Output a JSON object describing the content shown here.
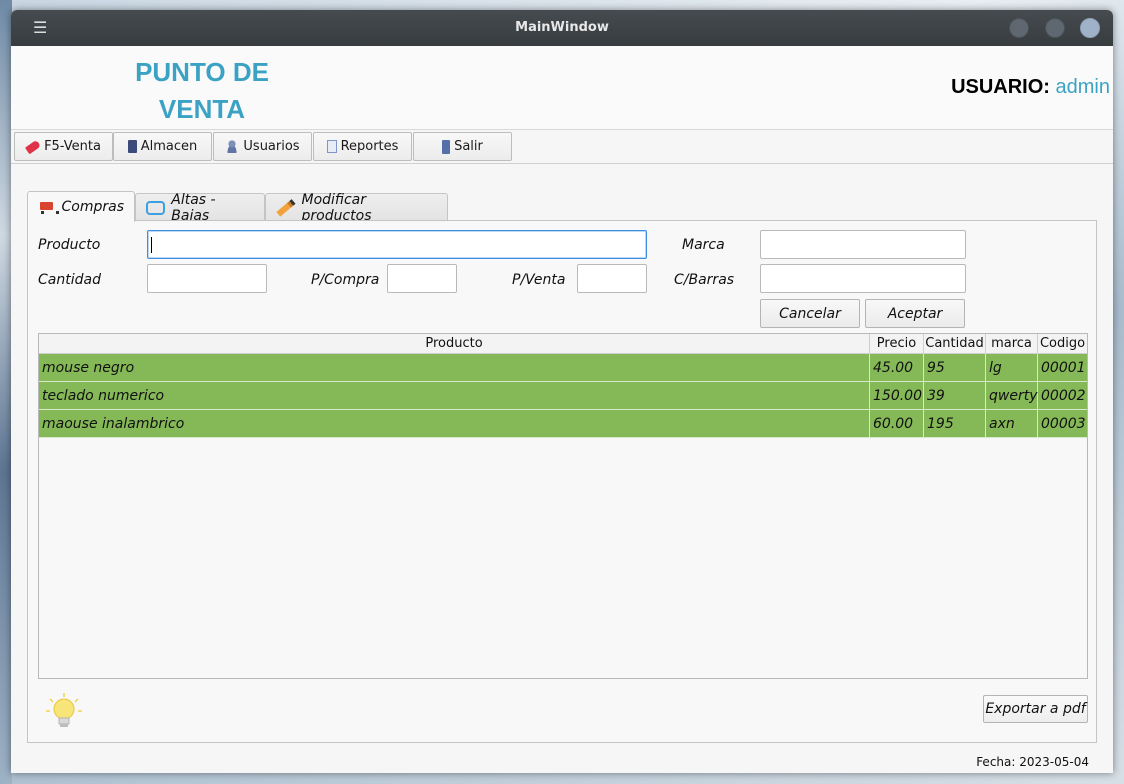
{
  "window": {
    "title": "MainWindow"
  },
  "header": {
    "brand_line1": "PUNTO DE",
    "brand_line2": "VENTA",
    "user_label": "USUARIO:",
    "user_name": "admin"
  },
  "toolbar": {
    "buttons": [
      {
        "label": "F5-Venta",
        "icon": "tag-icon"
      },
      {
        "label": "Almacen",
        "icon": "box-icon"
      },
      {
        "label": "Usuarios",
        "icon": "users-icon"
      },
      {
        "label": "Reportes",
        "icon": "document-icon"
      },
      {
        "label": "Salir",
        "icon": "exit-door-icon"
      }
    ]
  },
  "tabs": [
    {
      "label": "Compras",
      "icon": "shopping-cart-icon",
      "active": true
    },
    {
      "label": "Altas - Bajas",
      "icon": "swap-arrows-icon",
      "active": false
    },
    {
      "label": "Modificar productos",
      "icon": "pencil-icon",
      "active": false
    }
  ],
  "form": {
    "producto_label": "Producto",
    "producto_value": "",
    "marca_label": "Marca",
    "marca_value": "",
    "cantidad_label": "Cantidad",
    "cantidad_value": "",
    "pcompra_label": "P/Compra",
    "pcompra_value": "",
    "pventa_label": "P/Venta",
    "pventa_value": "",
    "cbarras_label": "C/Barras",
    "cbarras_value": "",
    "cancel_label": "Cancelar",
    "accept_label": "Aceptar"
  },
  "table": {
    "headers": [
      "Producto",
      "Precio",
      "Cantidad",
      "marca",
      "Codigo"
    ],
    "rows": [
      [
        "mouse negro",
        "45.00",
        "95",
        "lg",
        "00001"
      ],
      [
        "teclado numerico",
        "150.00",
        "39",
        "qwerty",
        "00002"
      ],
      [
        "maouse inalambrico",
        "60.00",
        "195",
        "axn",
        "00003"
      ]
    ],
    "row_color": "#85b857"
  },
  "footer": {
    "export_label": "Exportar a pdf",
    "bulb_icon": "lightbulb-icon",
    "fecha_label": "Fecha:",
    "fecha_value": "2023-05-04"
  },
  "colors": {
    "brand": "#3ba2c4",
    "titlebar": "#3e4346"
  }
}
